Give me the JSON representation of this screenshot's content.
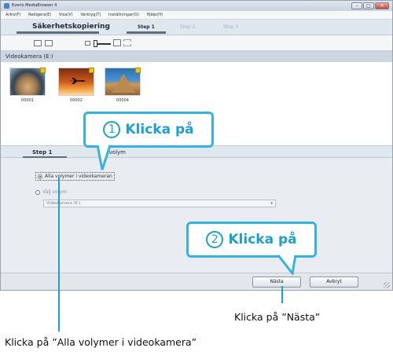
{
  "window": {
    "title": "Everio MediaBrowser 4",
    "controls": {
      "minimize": "–",
      "maximize": "□",
      "close": "✕"
    }
  },
  "menu": [
    "Arkiv(F)",
    "Redigera(E)",
    "Visa(V)",
    "Verktyg(T)",
    "Inställningar(O)",
    "Hjälp(H)"
  ],
  "stepbar": {
    "mode": "Säkerhetskopiering",
    "steps": [
      "Step 1",
      "Step 2",
      "Step 3"
    ],
    "active_step": 0
  },
  "viewbar": {
    "icons": [
      "grid-view-icon",
      "list-view-icon",
      "zoom-small-icon",
      "zoom-slider",
      "zoom-large-icon",
      "fit-icon"
    ]
  },
  "camera": {
    "header": "Videokamera (E:)",
    "thumbnails": [
      {
        "label": "00001",
        "icon": "aerial-city-thumbnail"
      },
      {
        "label": "00002",
        "icon": "airplane-sunset-thumbnail"
      },
      {
        "label": "00004",
        "icon": "pyramid-thumbnail"
      }
    ]
  },
  "panel": {
    "step": "Step 1",
    "title": "Välj volym",
    "option_all": "Alla volymer i videokameran",
    "option_choose": "Välj volym",
    "select_value": "Videokamera (E:)"
  },
  "footer": {
    "next": "Nästa",
    "cancel": "Avbryt"
  },
  "callouts": {
    "one": {
      "number": "1",
      "text": "Klicka på"
    },
    "two": {
      "number": "2",
      "text": "Klicka på"
    }
  },
  "annotations": {
    "next": "Klicka på ”Nästa”",
    "all": "Klicka på ”Alla volymer i videokamera”"
  },
  "colors": {
    "accent": "#36b2e2",
    "accent_text": "#1f9ed3"
  }
}
